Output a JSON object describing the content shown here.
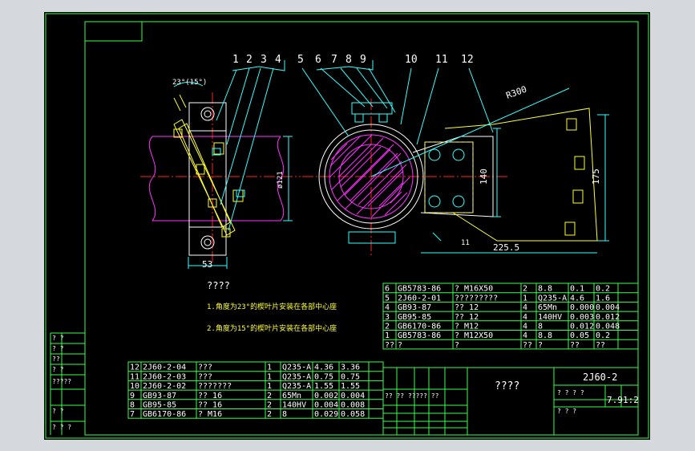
{
  "colors": {
    "frame": "#3cff4a",
    "geo": "#ffffff",
    "yellow": "#ffff33",
    "magenta": "#ff33ff",
    "cyan": "#33ffff",
    "red": "#ff2222",
    "bg": "#000000",
    "outer": "#d5d9de"
  },
  "labels": {
    "balloons": [
      "1",
      "2",
      "3",
      "4",
      "5",
      "6",
      "7",
      "8",
      "9",
      "10",
      "11",
      "12"
    ],
    "angle": "23°(15°)",
    "radius": "R300",
    "dim_140": "140",
    "dim_175": "175",
    "dim_225": "225.5",
    "dim_53": "53",
    "dim_phi": "ø121",
    "weld": "11"
  },
  "notes": {
    "title": "????",
    "line1": "1.角度为23°的楔叶片安装在各部中心座",
    "line2": "2.角度为15°的楔叶片安装在各部中心座"
  },
  "upper_bom": {
    "rows": [
      [
        "6",
        "GB5783-86",
        "?  M16X50",
        "2",
        "8.8",
        "0.1",
        "0.2"
      ],
      [
        "5",
        "2J60-2-01",
        "?????????",
        "1",
        "Q235-A",
        "4.6",
        "1.6"
      ],
      [
        "4",
        "GB93-87",
        "??  12",
        "4",
        "65Mn",
        "0.000",
        "0.004"
      ],
      [
        "3",
        "GB95-85",
        "??  12",
        "4",
        "140HV",
        "0.003",
        "0.012"
      ],
      [
        "2",
        "GB6170-86",
        "?  M12",
        "4",
        "8",
        "0.012",
        "0.048"
      ],
      [
        "1",
        "GB5783-86",
        "?  M12X50",
        "4",
        "8.8",
        "0.05",
        "0.2"
      ]
    ],
    "header": [
      "??",
      "?",
      "?",
      "??",
      "?",
      "??",
      "??"
    ]
  },
  "lower_bom": {
    "rows": [
      [
        "12",
        "2J60-2-04",
        "???",
        "1",
        "Q235-A",
        "4.36",
        "3.36"
      ],
      [
        "11",
        "2J60-2-03",
        "???",
        "1",
        "Q235-A",
        "0.75",
        "0.75"
      ],
      [
        "10",
        "2J60-2-02",
        "???????",
        "1",
        "Q235-A",
        "1.55",
        "1.55"
      ],
      [
        "9",
        "GB93-87",
        "??  16",
        "2",
        "65Mn",
        "0.002",
        "0.004"
      ],
      [
        "8",
        "GB95-85",
        "??  16",
        "2",
        "140HV",
        "0.004",
        "0.008"
      ],
      [
        "7",
        "GB6170-86",
        "?  M16",
        "2",
        "8",
        "0.029",
        "0.058"
      ]
    ]
  },
  "title_block": {
    "drawing_name": "????",
    "drawing_no": "2J60-2",
    "scale": "7.9",
    "ratio": "1:2",
    "row_q": "? ? ? ?",
    "small_row": "?? ?? ????? ??",
    "sheet": "?   ?   ?"
  },
  "side_block": {
    "lines": [
      "? ?",
      "? ?",
      "??",
      "? ?",
      "?????",
      "? ?",
      "? ? ?"
    ]
  }
}
